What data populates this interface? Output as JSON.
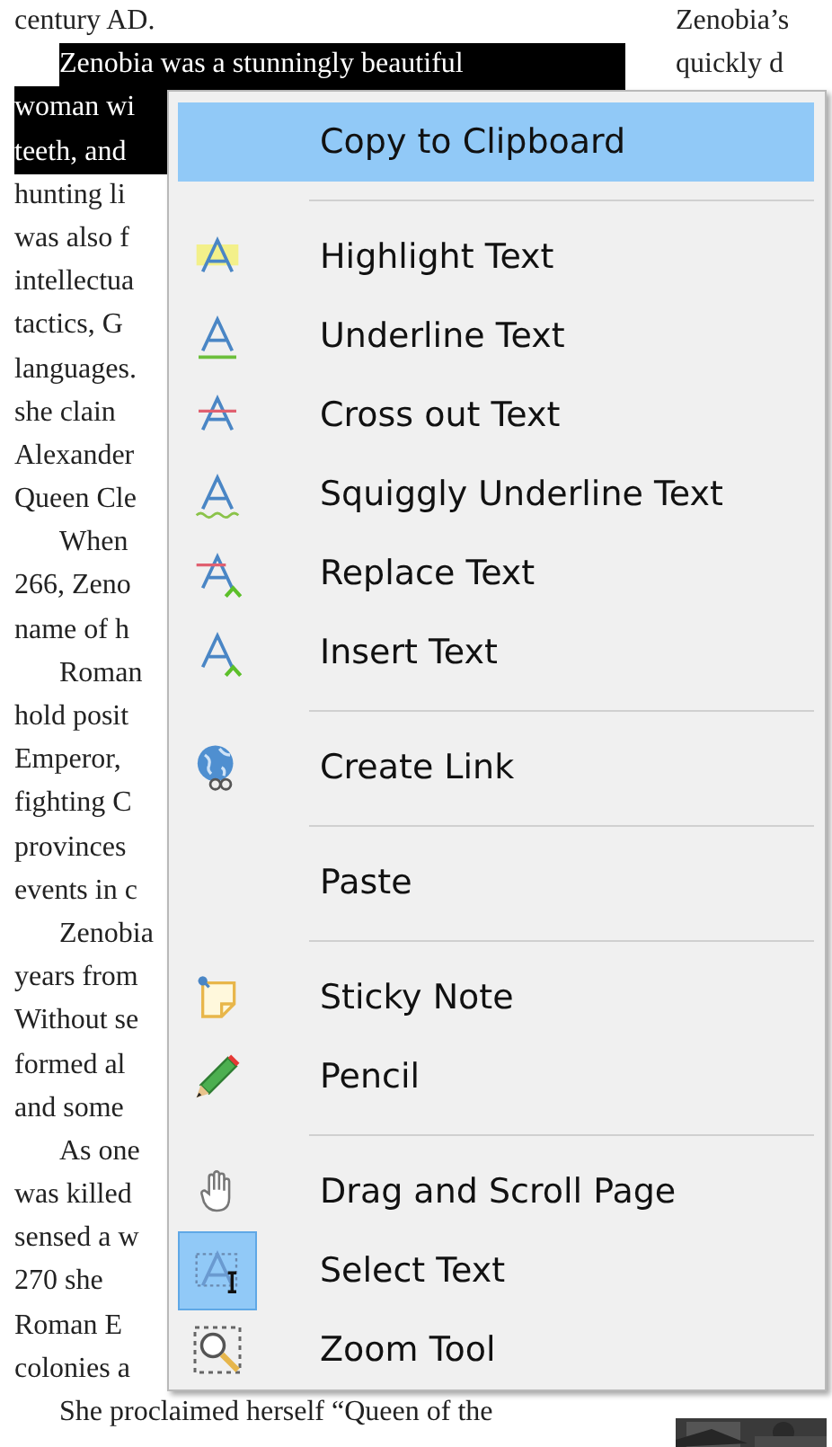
{
  "document": {
    "left_column": [
      {
        "lines": [
          {
            "text": "century AD.",
            "selected": false
          }
        ]
      },
      {
        "lines": [
          {
            "text": "Zenobia was a stunningly beautiful",
            "selected": true
          },
          {
            "text": "woman wi",
            "selected": true
          },
          {
            "text": "teeth, and",
            "selected": true
          },
          {
            "text": "hunting li",
            "selected": false
          },
          {
            "text": "was also f",
            "selected": false
          },
          {
            "text": "intellectua",
            "selected": false
          },
          {
            "text": "tactics, G",
            "selected": false
          },
          {
            "text": "languages.",
            "selected": false
          },
          {
            "text": "she clain",
            "selected": false
          },
          {
            "text": "Alexander",
            "selected": false
          },
          {
            "text": "Queen Cle",
            "selected": false
          }
        ]
      },
      {
        "lines": [
          {
            "text": "When",
            "selected": false
          },
          {
            "text": "266, Zeno",
            "selected": false
          },
          {
            "text": "name of h",
            "selected": false
          }
        ]
      },
      {
        "lines": [
          {
            "text": "Roman",
            "selected": false
          },
          {
            "text": "hold posit",
            "selected": false
          },
          {
            "text": "Emperor,",
            "selected": false
          },
          {
            "text": "fighting C",
            "selected": false
          },
          {
            "text": "provinces",
            "selected": false
          },
          {
            "text": "events in c",
            "selected": false
          }
        ]
      },
      {
        "lines": [
          {
            "text": "Zenobia",
            "selected": false
          },
          {
            "text": "years from",
            "selected": false
          },
          {
            "text": "Without se",
            "selected": false
          },
          {
            "text": "formed al",
            "selected": false
          },
          {
            "text": "and some",
            "selected": false
          }
        ]
      },
      {
        "lines": [
          {
            "text": "As one",
            "selected": false
          },
          {
            "text": "was killed",
            "selected": false
          },
          {
            "text": "sensed a w",
            "selected": false
          },
          {
            "text": "270 she",
            "selected": false
          },
          {
            "text": "Roman E",
            "selected": false
          },
          {
            "text": "colonies a",
            "selected": false
          }
        ]
      },
      {
        "lines": [
          {
            "text": "She proclaimed herself “Queen of the",
            "selected": false
          }
        ]
      }
    ],
    "right_column": [
      "Zenobia’s",
      "quickly d"
    ],
    "right_picture": {
      "kind": "picture"
    }
  },
  "context_menu": {
    "items": [
      {
        "kind": "item",
        "label": "Copy to Clipboard",
        "selected": true,
        "checked": false
      },
      {
        "kind": "separator"
      },
      {
        "kind": "item",
        "label": "Highlight Text",
        "selected": false,
        "checked": false
      },
      {
        "kind": "item",
        "label": "Underline Text",
        "selected": false,
        "checked": false
      },
      {
        "kind": "item",
        "label": "Cross out Text",
        "selected": false,
        "checked": false
      },
      {
        "kind": "item",
        "label": "Squiggly Underline Text",
        "selected": false,
        "checked": false
      },
      {
        "kind": "item",
        "label": "Replace Text",
        "selected": false,
        "checked": false
      },
      {
        "kind": "item",
        "label": "Insert Text",
        "selected": false,
        "checked": false
      },
      {
        "kind": "separator"
      },
      {
        "kind": "item",
        "label": "Create Link",
        "selected": false,
        "checked": false
      },
      {
        "kind": "separator"
      },
      {
        "kind": "item",
        "label": "Paste",
        "selected": false,
        "checked": false
      },
      {
        "kind": "separator"
      },
      {
        "kind": "item",
        "label": "Sticky Note",
        "selected": false,
        "checked": false
      },
      {
        "kind": "item",
        "label": "Pencil",
        "selected": false,
        "checked": false
      },
      {
        "kind": "separator"
      },
      {
        "kind": "item",
        "label": "Drag and Scroll Page",
        "selected": false,
        "checked": false
      },
      {
        "kind": "item",
        "label": "Select Text",
        "selected": false,
        "checked": true
      },
      {
        "kind": "item",
        "label": "Zoom Tool",
        "selected": false,
        "checked": false
      }
    ]
  }
}
